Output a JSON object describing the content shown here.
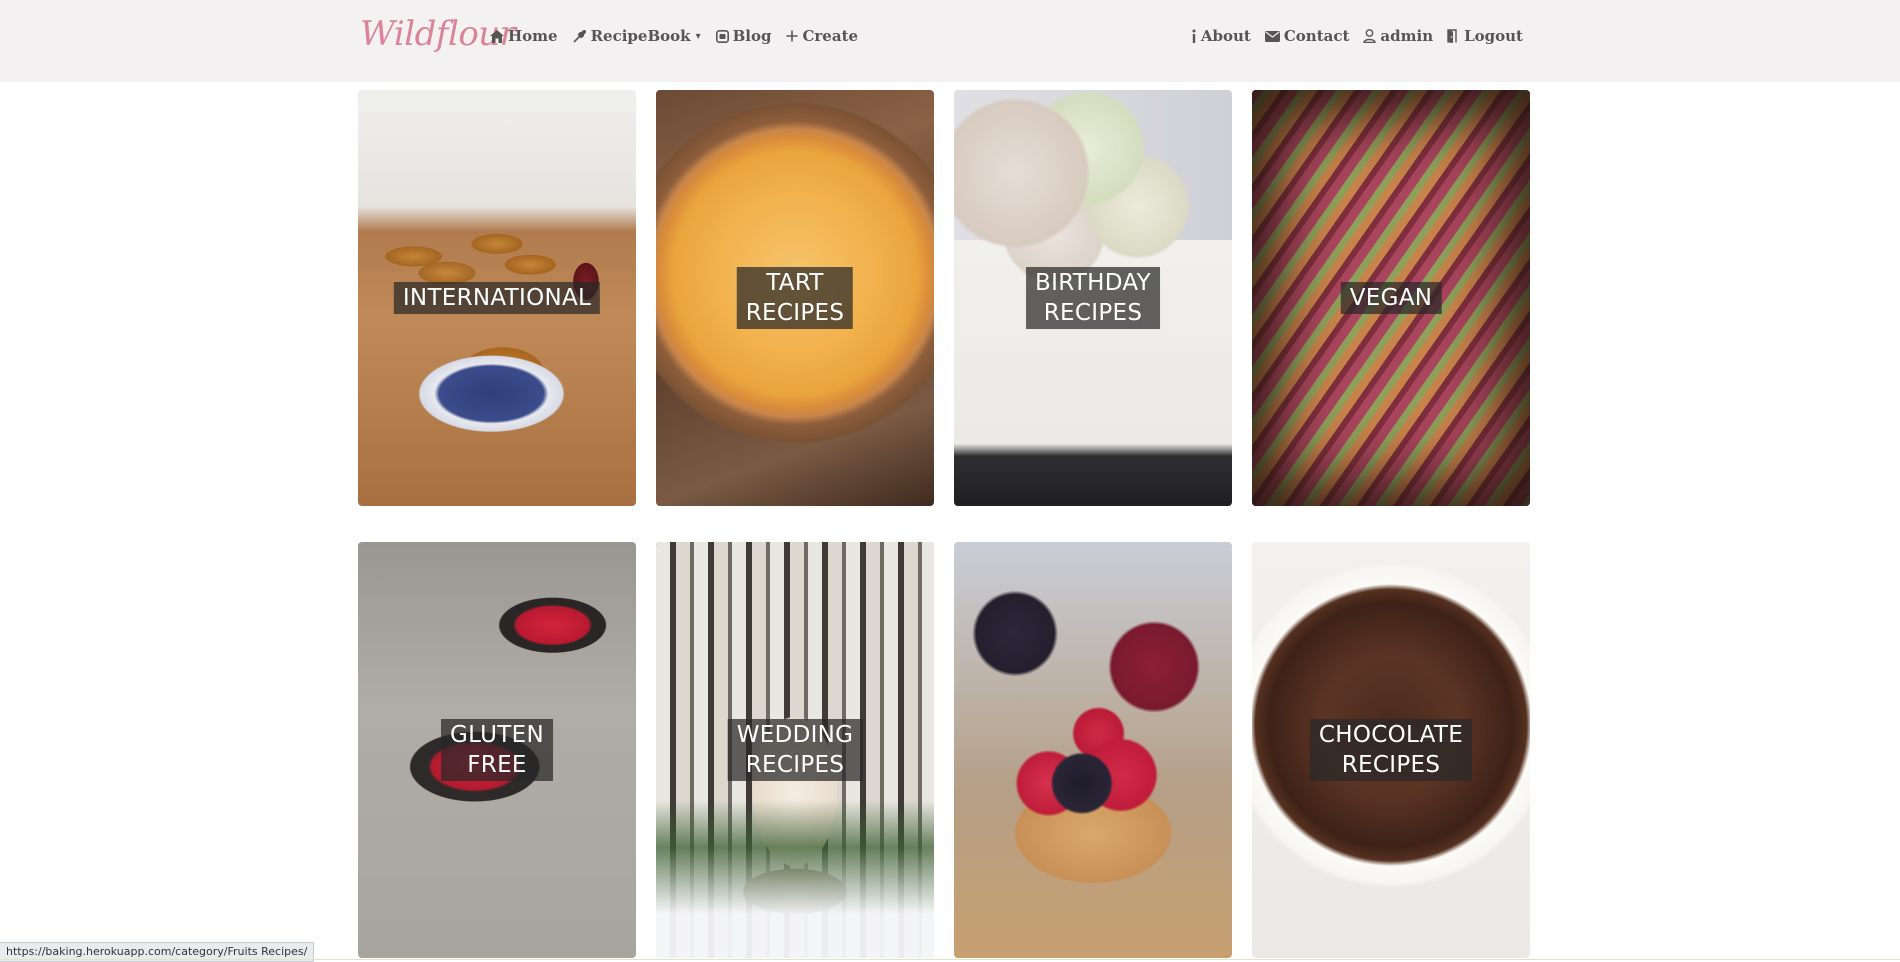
{
  "brand": {
    "name": "Wildflour"
  },
  "nav": {
    "left": [
      {
        "label": "Home",
        "icon": "home-icon"
      },
      {
        "label": "RecipeBook",
        "icon": "wheat-icon",
        "caret": "▾"
      },
      {
        "label": "Blog",
        "icon": "blog-icon"
      },
      {
        "label": "Create",
        "icon": "plus-icon"
      }
    ],
    "right": [
      {
        "label": "About",
        "icon": "info-icon"
      },
      {
        "label": "Contact",
        "icon": "envelope-icon"
      },
      {
        "label": "admin",
        "icon": "user-icon"
      },
      {
        "label": "Logout",
        "icon": "door-icon"
      }
    ]
  },
  "categories": [
    {
      "label": "INTERNATIONAL"
    },
    {
      "label": "TART\nRECIPES"
    },
    {
      "label": "BIRTHDAY\nRECIPES"
    },
    {
      "label": "VEGAN"
    },
    {
      "label": "GLUTEN\nFREE"
    },
    {
      "label": "WEDDING\nRECIPES"
    },
    {
      "label": ""
    },
    {
      "label": "CHOCOLATE\nRECIPES"
    }
  ],
  "status_bar": {
    "url": "https://baking.herokuapp.com/category/Fruits Recipes/"
  },
  "colors": {
    "brand": "#d9849a",
    "navbar_bg": "#f4f1f2",
    "nav_text": "#555555",
    "label_bg": "#282828"
  }
}
